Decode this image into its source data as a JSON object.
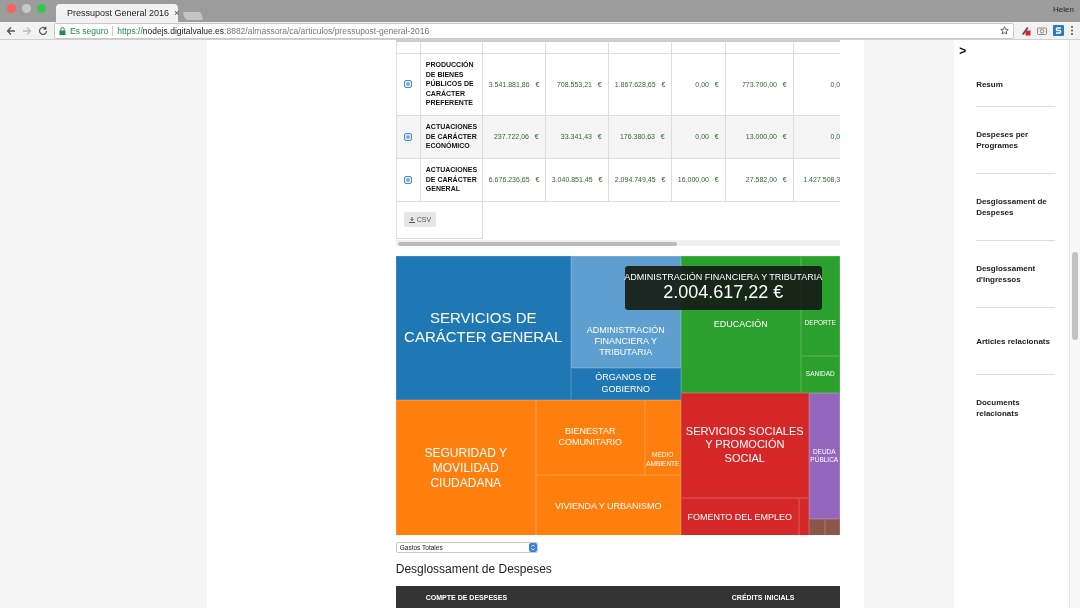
{
  "browser": {
    "tab_title": "Pressupost General 2016",
    "tab_close": "×",
    "user": "Helen",
    "security": "Es seguro",
    "url": {
      "scheme": "https://",
      "host": "nodejs.digitalvalue.es",
      "path": ":8882/almassora/ca/articulos/pressupost-general-2016"
    }
  },
  "table": {
    "rows": [
      {
        "name": "PRODUCCIÓN DE BIENES PÚBLICOS DE CARÁCTER PREFERENTE",
        "values": [
          "3.541.881,86 €",
          "708.553,21 €",
          "1.867.628,65 €",
          "0,00 €",
          "773.700,00 €",
          "0,0"
        ]
      },
      {
        "name": "ACTUACIONES DE CARÁCTER ECONÓMICO",
        "values": [
          "237.722,06 €",
          "33.341,43 €",
          "176.380,63 €",
          "0,00 €",
          "13.000,00 €",
          "0,0"
        ]
      },
      {
        "name": "ACTUACIONES DE CARÁCTER GENERAL",
        "values": [
          "6.676.236,65 €",
          "3.040.851,45 €",
          "2.094.749,45 €",
          "16.000,00 €",
          "27.582,00 €",
          "1.427.508,3"
        ]
      }
    ],
    "csv_button": "CSV"
  },
  "treemap": {
    "tiles": [
      {
        "label": "SERVICIOS DE CARÁCTER GENERAL",
        "color": "#1f77b4"
      },
      {
        "label": "ADMINISTRACIÓN FINANCIERA Y TRIBUTARIA",
        "color": "#5f9fd0"
      },
      {
        "label": "ÓRGANOS DE GOBIERNO",
        "color": "#1f77b4"
      },
      {
        "label": "EDUCACIÓN",
        "color": "#2ca02c"
      },
      {
        "label": "DEPORTE",
        "color": "#2ca02c"
      },
      {
        "label": "SANIDAD",
        "color": "#2ca02c"
      },
      {
        "label": "SEGURIDAD Y MOVILIDAD CIUDADANA",
        "color": "#ff7f0e"
      },
      {
        "label": "BIENESTAR COMUNITARIO",
        "color": "#ff7f0e"
      },
      {
        "label": "MEDIO AMBIENTE",
        "color": "#ff7f0e"
      },
      {
        "label": "VIVIENDA Y URBANISMO",
        "color": "#ff7f0e"
      },
      {
        "label": "SERVICIOS SOCIALES Y PROMOCIÓN SOCIAL",
        "color": "#d62728"
      },
      {
        "label": "FOMENTO DEL EMPLEO",
        "color": "#d62728"
      },
      {
        "label": "DEUDA PÚBLICA",
        "color": "#9467bd"
      }
    ],
    "tooltip": {
      "title": "ADMINISTRACIÓN FINANCIERA Y TRIBUTARIA",
      "value": "2.004.617,22 €"
    }
  },
  "select": {
    "value": "Gastos Totales"
  },
  "section": {
    "title": "Desglossament de Despeses",
    "columns": [
      "COMPTE DE DESPESES",
      "CRÉDITS INICIALS"
    ]
  },
  "sidebar": {
    "toggle": ">",
    "items": [
      "Resum",
      "Despeses per Programes",
      "Desglossament de Despeses",
      "Desglossament d'Ingressos",
      "Articles relacionats",
      "Documents relacionats"
    ]
  }
}
